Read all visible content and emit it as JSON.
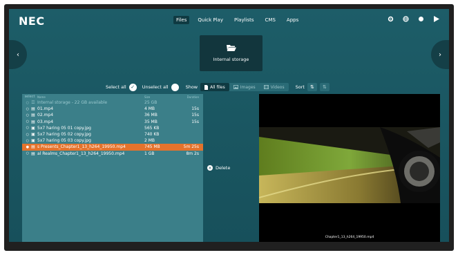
{
  "brand": "NEC",
  "nav": {
    "files": "Files",
    "quick_play": "Quick Play",
    "playlists": "Playlists",
    "cms": "CMS",
    "apps": "Apps"
  },
  "icons": {
    "settings": "gear-icon",
    "globe": "globe-icon",
    "status": "dot-icon",
    "play": "play-icon"
  },
  "storage": {
    "label": "Internal storage"
  },
  "toolbar": {
    "select_all": "Select all",
    "unselect_all": "Unselect all",
    "show": "Show",
    "all_files": "All files",
    "images": "Images",
    "videos": "Videos",
    "sort": "Sort"
  },
  "table": {
    "headers": {
      "check": "select",
      "name": "Name",
      "size": "Size",
      "duration": "Duration"
    },
    "rows": [
      {
        "check": "○",
        "name": "Internal storage - 22 GB available",
        "size": "25 GB",
        "duration": "",
        "dim": true
      },
      {
        "check": "○",
        "name": "01.mp4",
        "size": "4 MB",
        "duration": "15s"
      },
      {
        "check": "○",
        "name": "02.mp4",
        "size": "36 MB",
        "duration": "15s"
      },
      {
        "check": "○",
        "name": "03.mp4",
        "size": "35 MB",
        "duration": "15s"
      },
      {
        "check": "○",
        "name": "5x7 haring 05 01 copy.jpg",
        "size": "565 KB",
        "duration": ""
      },
      {
        "check": "○",
        "name": "5x7 haring 05 02 copy.jpg",
        "size": "740 KB",
        "duration": ""
      },
      {
        "check": "○",
        "name": "5x7 haring 05 03 copy.jpg",
        "size": "2 MB",
        "duration": ""
      },
      {
        "check": "●",
        "name": "s Presents_Chapter1_13_h264_19950.mp4",
        "size": "745 MB",
        "duration": "5m 25s",
        "selected": true
      },
      {
        "check": "○",
        "name": "al Realms_Chapter1_13_h264_19950.mp4",
        "size": "1 GB",
        "duration": "8m 2s"
      }
    ]
  },
  "actions": {
    "delete": "Delete"
  },
  "preview": {
    "caption": "Chapter1_13_h264_19950.mp4"
  },
  "colors": {
    "background": "#1b5560",
    "selected_row": "#e4732c",
    "panel": "#3b7f89"
  }
}
